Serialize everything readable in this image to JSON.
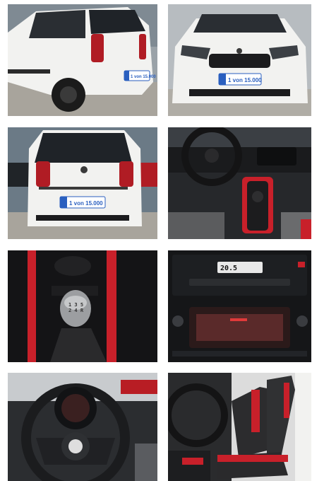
{
  "gallery": {
    "photos": [
      {
        "subject": "rear-quarter-exterior",
        "plate_text": "1 von 15.000",
        "badge_text": ""
      },
      {
        "subject": "front-exterior",
        "plate_text": "1 von 15.000"
      },
      {
        "subject": "rear-exterior",
        "plate_text": "1 von 15.000"
      },
      {
        "subject": "interior-dashboard"
      },
      {
        "subject": "gear-shift-closeup"
      },
      {
        "subject": "infotainment-climate-panel",
        "climate_temp": "20.5"
      },
      {
        "subject": "steering-wheel-cluster"
      },
      {
        "subject": "front-seats"
      }
    ]
  },
  "colors": {
    "car_white": "#f2f2f0",
    "accent_red": "#c8202a",
    "plate_blue": "#2a5fbf",
    "interior_dark": "#1c1c1e"
  }
}
